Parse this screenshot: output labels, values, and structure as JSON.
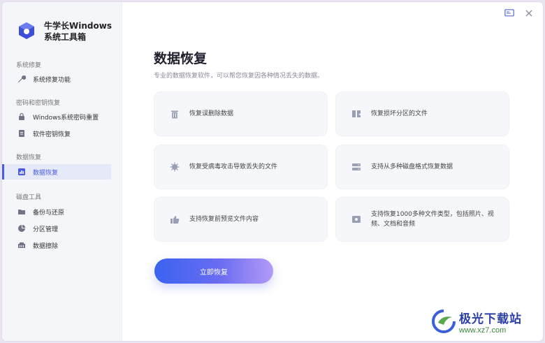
{
  "app": {
    "title": "牛学长Windows系统工具箱"
  },
  "sidebar": {
    "sections": [
      {
        "label": "系统修复",
        "items": [
          {
            "label": "系统修复功能",
            "icon": "wrench-icon"
          }
        ]
      },
      {
        "label": "密码和密钥恢复",
        "items": [
          {
            "label": "Windows系统密码重置",
            "icon": "lock-icon"
          },
          {
            "label": "软件密钥恢复",
            "icon": "document-icon"
          }
        ]
      },
      {
        "label": "数据恢复",
        "items": [
          {
            "label": "数据恢复",
            "icon": "data-icon",
            "active": true
          }
        ]
      },
      {
        "label": "磁盘工具",
        "items": [
          {
            "label": "备份与还原",
            "icon": "folder-icon"
          },
          {
            "label": "分区管理",
            "icon": "pie-icon"
          },
          {
            "label": "数据擦除",
            "icon": "erase-icon"
          }
        ]
      }
    ]
  },
  "main": {
    "title": "数据恢复",
    "subtitle": "专业的数据恢复软件，可以帮您恢复因各种情况丢失的数据。",
    "cards": [
      {
        "text": "恢复误删除数据",
        "icon": "trash-icon"
      },
      {
        "text": "恢复损坏分区的文件",
        "icon": "damaged-partition-icon"
      },
      {
        "text": "恢复受病毒攻击导致丢失的文件",
        "icon": "virus-icon"
      },
      {
        "text": "支持从多种磁盘格式恢复数据",
        "icon": "disk-icon"
      },
      {
        "text": "支持恢复前预览文件内容",
        "icon": "thumbs-up-icon"
      },
      {
        "text": "支持恢复1000多种文件类型，包括照片、视频、文档和音频",
        "icon": "file-types-icon"
      }
    ],
    "action_label": "立即恢复"
  },
  "watermark": {
    "name": "极光下载站",
    "url": "www.xz7.com"
  },
  "colors": {
    "accent": "#4a5ce0",
    "icon_gray": "#9aa0b4"
  }
}
